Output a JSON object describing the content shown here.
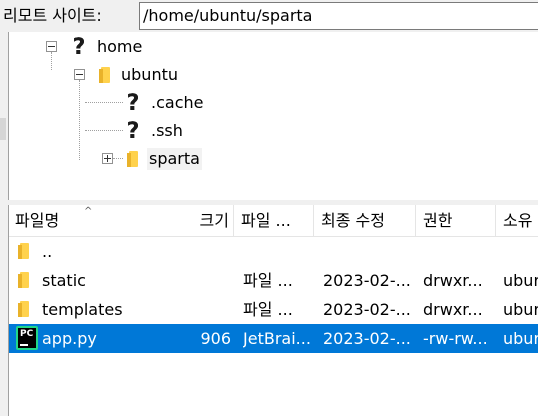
{
  "path_bar": {
    "label": "리모트 사이트:",
    "path": "/home/ubuntu/sparta"
  },
  "tree": [
    {
      "label": "home",
      "icon": "question-icon",
      "expander": "minus"
    },
    {
      "label": "ubuntu",
      "icon": "folder-icon",
      "expander": "minus"
    },
    {
      "label": ".cache",
      "icon": "question-icon",
      "expander": ""
    },
    {
      "label": ".ssh",
      "icon": "question-icon",
      "expander": ""
    },
    {
      "label": "sparta",
      "icon": "folder-icon",
      "expander": "plus"
    }
  ],
  "file_list": {
    "columns": [
      "파일명",
      "크기",
      "파일 ...",
      "최종 수정",
      "권한",
      "소유"
    ],
    "rows": [
      {
        "name": "..",
        "size": "",
        "type": "",
        "modified": "",
        "perms": "",
        "owner": "",
        "icon": "folder-icon"
      },
      {
        "name": "static",
        "size": "",
        "type": "파일 ...",
        "modified": "2023-02-...",
        "perms": "drwxr...",
        "owner": "ubur",
        "icon": "folder-icon"
      },
      {
        "name": "templates",
        "size": "",
        "type": "파일 ...",
        "modified": "2023-02-...",
        "perms": "drwxr...",
        "owner": "ubur",
        "icon": "folder-icon"
      },
      {
        "name": "app.py",
        "size": "906",
        "type": "JetBrai...",
        "modified": "2023-02-...",
        "perms": "-rw-rw...",
        "owner": "ubur",
        "icon": "pycharm-file-icon",
        "selected": true
      }
    ]
  },
  "icon_text": {
    "pycharm": "PC"
  },
  "colors": {
    "selection": "#0078d7",
    "folder": "#ffd24d"
  }
}
